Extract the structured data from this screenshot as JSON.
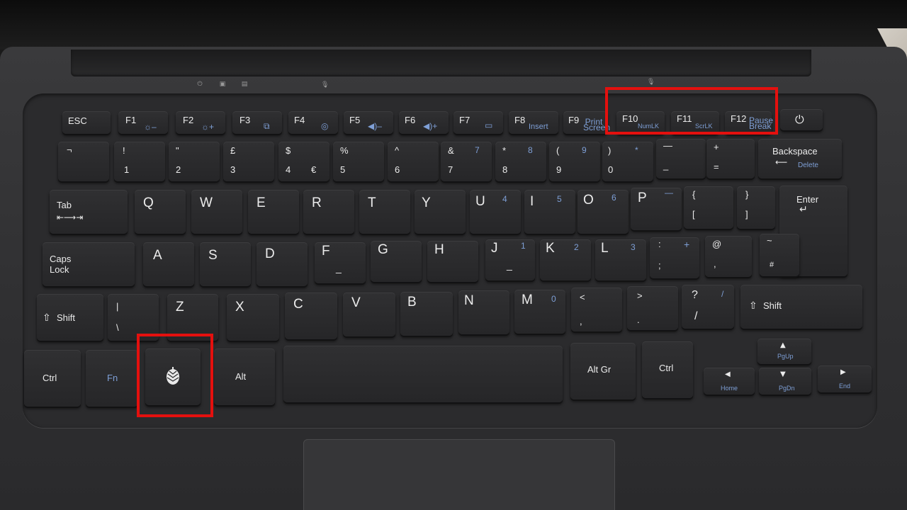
{
  "function_row": {
    "esc": "ESC",
    "f1": "F1",
    "f2": "F2",
    "f3": "F3",
    "f4": "F4",
    "f5": "F5",
    "f6": "F6",
    "f7": "F7",
    "f8": "F8",
    "f8_alt": "Insert",
    "f9": "F9",
    "f9_alt": "Print Screen",
    "f10": "F10",
    "f10_alt": "NumLK",
    "f11": "F11",
    "f11_alt": "ScrLK",
    "f12": "F12",
    "f12_alt": "Pause Break",
    "power_icon": "power-icon"
  },
  "number_row": {
    "grave": "¬",
    "k1": "!",
    "k1b": "1",
    "k2": "\"",
    "k2b": "2",
    "k3": "£",
    "k3b": "3",
    "k4": "$",
    "k4b": "4",
    "k4c": "€",
    "k5": "%",
    "k5b": "5",
    "k6": "^",
    "k6b": "6",
    "k7": "&",
    "k7b": "7",
    "k7n": "7",
    "k8": "*",
    "k8b": "8",
    "k8n": "8",
    "k9": "(",
    "k9b": "9",
    "k9n": "9",
    "k0": ")",
    "k0b": "0",
    "k0n": "*",
    "minus": "—",
    "minusb": "_",
    "plus": "+",
    "plusb": "=",
    "backspace": "Backspace",
    "delete": "Delete"
  },
  "top_row": {
    "tab": "Tab",
    "q": "Q",
    "w": "W",
    "e": "E",
    "r": "R",
    "t": "T",
    "y": "Y",
    "u": "U",
    "un": "4",
    "i": "I",
    "in": "5",
    "o": "O",
    "on": "6",
    "p": "P",
    "pn": "—",
    "lbrace": "{",
    "lbracket": "[",
    "rbrace": "}",
    "rbracket": "]",
    "enter": "Enter"
  },
  "home_row": {
    "caps": "Caps",
    "caps2": "Lock",
    "a": "A",
    "s": "S",
    "d": "D",
    "f": "F",
    "g": "G",
    "h": "H",
    "j": "J",
    "jn": "1",
    "k": "K",
    "kn": "2",
    "l": "L",
    "ln": "3",
    "colon": ":",
    "semi": ";",
    "semin": "+",
    "at": "@",
    "apos": ",",
    "tilde": "~",
    "hash": "#"
  },
  "bottom_row": {
    "lshift": "Shift",
    "pipe": "|",
    "backslash": "\\",
    "z": "Z",
    "x": "X",
    "c": "C",
    "v": "V",
    "b": "B",
    "n": "N",
    "m": "M",
    "mn": "0",
    "lt": "<",
    "comma": ",",
    "gt": ">",
    "period": ".",
    "q": "?",
    "slash": "/",
    "slashn": "/",
    "rshift": "Shift"
  },
  "space_row": {
    "ctrl": "Ctrl",
    "fn": "Fn",
    "logo_icon": "pinecone-logo-icon",
    "alt": "Alt",
    "altgr": "Alt Gr",
    "rctrl": "Ctrl",
    "pgup": "PgUp",
    "home": "Home",
    "pgdn": "PgDn",
    "end": "End"
  },
  "highlight_color": "#e4100e"
}
